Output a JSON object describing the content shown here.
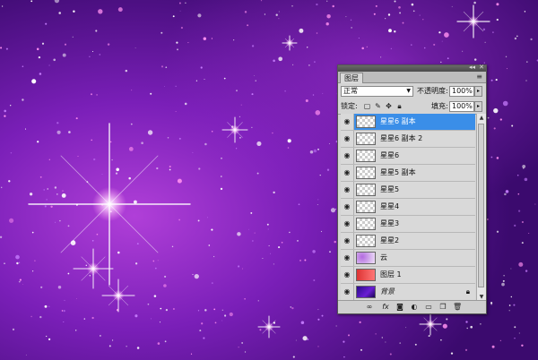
{
  "panel": {
    "tab_label": "图层",
    "top_collapse": "◂◂",
    "top_close": "✕",
    "menu_icon": "≡",
    "blend_mode": "正常",
    "opacity_label": "不透明度:",
    "opacity_value": "100%",
    "lock_label": "锁定:",
    "fill_label": "填充:",
    "fill_value": "100%"
  },
  "layers": [
    {
      "name": "星星6 副本",
      "thumb": "transparent",
      "selected": true
    },
    {
      "name": "星星6 副本 2",
      "thumb": "transparent",
      "selected": false
    },
    {
      "name": "星星6",
      "thumb": "transparent",
      "selected": false
    },
    {
      "name": "星星5 副本",
      "thumb": "transparent",
      "selected": false
    },
    {
      "name": "星星5",
      "thumb": "transparent",
      "selected": false
    },
    {
      "name": "星星4",
      "thumb": "transparent",
      "selected": false
    },
    {
      "name": "星星3",
      "thumb": "transparent",
      "selected": false
    },
    {
      "name": "星星2",
      "thumb": "transparent",
      "selected": false
    },
    {
      "name": "云",
      "thumb": "purple",
      "selected": false
    },
    {
      "name": "图层 1",
      "thumb": "red",
      "selected": false
    },
    {
      "name": "背景",
      "thumb": "dark",
      "selected": false,
      "locked": true
    }
  ],
  "colors": {
    "selection": "#3a8ee8",
    "canvas_deep": "#3b0a6e",
    "canvas_mid": "#7a1fb8",
    "canvas_pink": "#d34fd8"
  }
}
